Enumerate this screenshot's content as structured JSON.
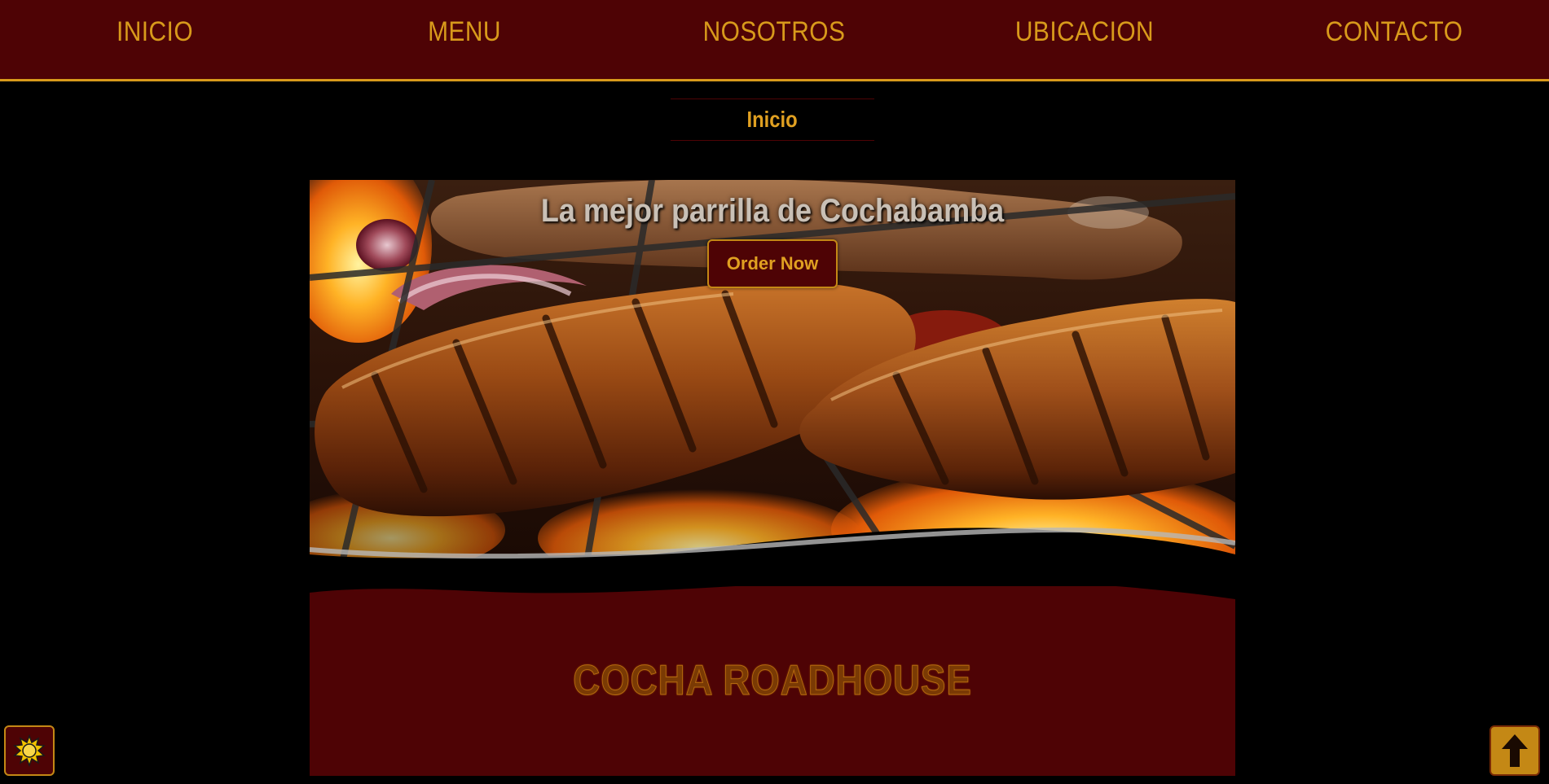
{
  "nav": {
    "items": [
      {
        "label": "INICIO"
      },
      {
        "label": "MENU"
      },
      {
        "label": "NOSOTROS"
      },
      {
        "label": "UBICACION"
      },
      {
        "label": "CONTACTO"
      }
    ]
  },
  "section": {
    "title": "Inicio"
  },
  "hero": {
    "headline": "La mejor parrilla de Cochabamba",
    "order_button": "Order Now"
  },
  "brand": {
    "name": "COCHA ROADHOUSE"
  },
  "floating": {
    "theme_icon": "sun-icon",
    "top_icon": "arrow-up-icon"
  },
  "colors": {
    "nav_bg": "#4e0305",
    "accent": "#d89a1b",
    "page_bg": "#000000",
    "brand_text": "#7a3a04"
  }
}
